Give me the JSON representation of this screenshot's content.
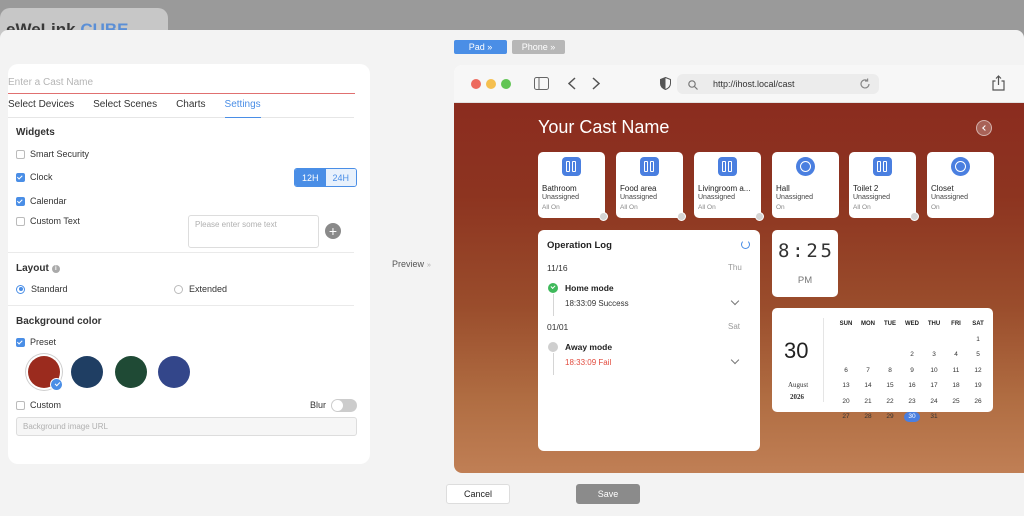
{
  "background_app": {
    "brand": "eWeLink ",
    "brand_accent": "CUBE"
  },
  "editor": {
    "cast_name_placeholder": "Enter a Cast Name",
    "tabs": [
      "Select Devices",
      "Select Scenes",
      "Charts",
      "Settings"
    ],
    "active_tab": "Settings",
    "widgets": {
      "title": "Widgets",
      "smart_security": "Smart Security",
      "clock": "Clock",
      "clock_format_12h": "12H",
      "clock_format_24h": "24H",
      "calendar": "Calendar",
      "custom_text": "Custom Text",
      "custom_text_placeholder": "Please enter some text"
    },
    "layout": {
      "title": "Layout",
      "standard": "Standard",
      "extended": "Extended"
    },
    "background": {
      "title": "Background color",
      "preset": "Preset",
      "swatches": [
        "#9b2b1e",
        "#1f3e63",
        "#1f4a35",
        "#33468a"
      ],
      "custom": "Custom",
      "blur": "Blur",
      "url_placeholder": "Background image URL"
    }
  },
  "preview": {
    "label": "Preview",
    "arrow": "»",
    "device_pad": "Pad »",
    "device_phone": "Phone »",
    "url": "http://ihost.local/cast",
    "cast_title": "Your Cast Name",
    "devices": [
      {
        "name": "Bathroom",
        "status": "Unassigned",
        "sub": "All On",
        "icon": "switch"
      },
      {
        "name": "Food area",
        "status": "Unassigned",
        "sub": "All On",
        "icon": "switch"
      },
      {
        "name": "Livingroom a...",
        "status": "Unassigned",
        "sub": "All On",
        "icon": "switch"
      },
      {
        "name": "Hall",
        "status": "Unassigned",
        "sub": "On",
        "icon": "plug"
      },
      {
        "name": "Toilet 2",
        "status": "Unassigned",
        "sub": "All On",
        "icon": "switch"
      },
      {
        "name": "Closet",
        "status": "Unassigned",
        "sub": "On",
        "icon": "plug"
      }
    ],
    "operation_log": {
      "title": "Operation Log",
      "groups": [
        {
          "date": "11/16",
          "dow": "Thu",
          "mode": "Home mode",
          "result": "18:33:09 Success",
          "ok": true
        },
        {
          "date": "01/01",
          "dow": "Sat",
          "mode": "Away mode",
          "result": "18:33:09 Fail",
          "ok": false
        }
      ]
    },
    "clock": {
      "d1": "8",
      "colon": ":",
      "d2": "2",
      "d3": "5",
      "ampm": "PM"
    },
    "calendar": {
      "day": "30",
      "month": "August",
      "year": "2026",
      "headers": [
        "SUN",
        "MON",
        "TUE",
        "WED",
        "THU",
        "FRI",
        "SAT"
      ],
      "weeks": [
        [
          "",
          "",
          "",
          "",
          "",
          "",
          "1"
        ],
        [
          "",
          "",
          "",
          "2",
          "3",
          "4",
          "5"
        ],
        [
          "6",
          "7",
          "8",
          "9",
          "10",
          "11",
          "12"
        ],
        [
          "13",
          "14",
          "15",
          "16",
          "17",
          "18",
          "19"
        ],
        [
          "20",
          "21",
          "22",
          "23",
          "24",
          "25",
          "26"
        ],
        [
          "27",
          "28",
          "29",
          "30",
          "31",
          "",
          ""
        ]
      ],
      "today": "30"
    }
  },
  "actions": {
    "cancel": "Cancel",
    "save": "Save"
  }
}
